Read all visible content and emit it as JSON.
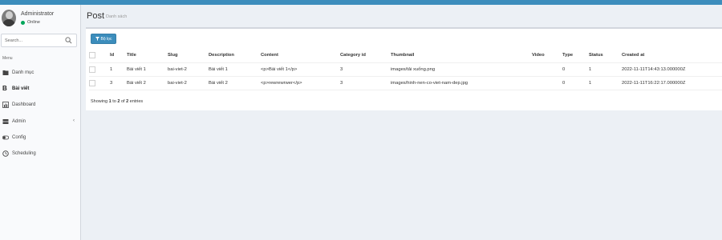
{
  "user": {
    "name": "Administrator",
    "status": "Online"
  },
  "search": {
    "placeholder": "Search..."
  },
  "menu": {
    "header": "Menu",
    "items": [
      {
        "label": "Danh mục"
      },
      {
        "label": "Bài viết"
      },
      {
        "label": "Dashboard"
      },
      {
        "label": "Admin"
      },
      {
        "label": "Config"
      },
      {
        "label": "Scheduling"
      }
    ]
  },
  "page": {
    "title": "Post",
    "subtitle": "Danh sách"
  },
  "filter_button": {
    "label": "Bộ lọc"
  },
  "table": {
    "headers": [
      "Id",
      "Title",
      "Slug",
      "Description",
      "Content",
      "Category id",
      "Thumbnail",
      "Video",
      "Type",
      "Status",
      "Created at"
    ],
    "rows": [
      [
        "1",
        "Bài viết 1",
        "bai-viet-2",
        "Bài viết 1",
        "<p>Bài viết 1</p>",
        "3",
        "images/tải xuống.png",
        "",
        "0",
        "1",
        "2022-11-11T14:43:13.000000Z"
      ],
      [
        "3",
        "Bài viết 2",
        "bai-viet-2",
        "Bài viết 2",
        "<p>rewrewrwer</p>",
        "3",
        "images/hinh-nen-co-viet-nam-dep.jpg",
        "",
        "0",
        "1",
        "2022-11-11T16:22:17.000000Z"
      ]
    ]
  },
  "footer": {
    "prefix": "Showing ",
    "from": "1",
    "to_word": " to ",
    "to": "2",
    "of_word": " of ",
    "total": "2",
    "suffix": " entries"
  },
  "colors": {
    "brand": "#3c8dbc",
    "online": "#00a65a"
  }
}
